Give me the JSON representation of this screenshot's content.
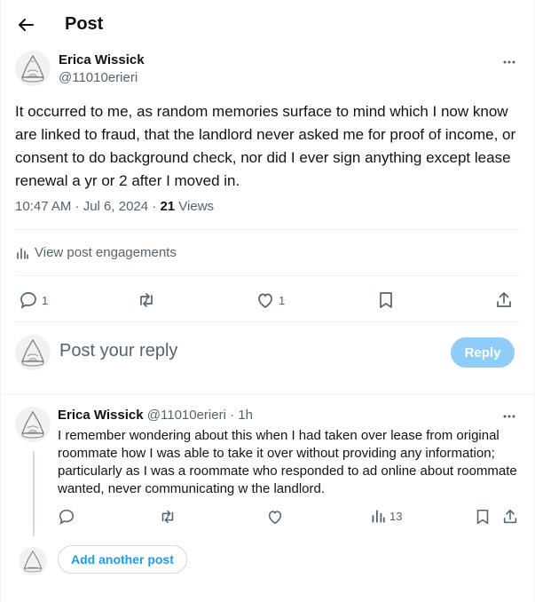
{
  "header": {
    "title": "Post"
  },
  "post": {
    "author_name": "Erica Wissick",
    "author_handle": "@11010erieri",
    "text": "It occurred to me, as random memories surface to mind which I now know are linked to fraud, that the landlord never asked me for proof of income, or consent to do background check, nor did I ever sign anything except lease renewal a yr or 2 after I moved in.",
    "time": "10:47 AM · Jul 6, 2024 · ",
    "views_count": "21",
    "views_label": " Views",
    "engagements_label": "View post engagements",
    "replies": "1",
    "likes": "1"
  },
  "composer": {
    "placeholder": "Post your reply",
    "button_label": "Reply"
  },
  "reply": {
    "author_name": "Erica Wissick",
    "author_handle": "@11010erieri",
    "time": "· 1h",
    "text": "I remember wondering about this when I had taken over lease from original roommate how I was able to take it over without providing any information; particularly as I was a roommate who responded to ad online about roommate wanted, never communicating w the landlord.",
    "views": "13"
  },
  "add_another": {
    "label": "Add another post"
  },
  "icons": [
    "back-arrow-icon",
    "more-icon",
    "reply-icon",
    "repost-icon",
    "like-icon",
    "bookmark-icon",
    "share-icon",
    "analytics-icon"
  ],
  "colors": {
    "accent": "#1d9bf0",
    "reply_button_disabled": "#8ecdf8",
    "muted_text": "#536471"
  }
}
